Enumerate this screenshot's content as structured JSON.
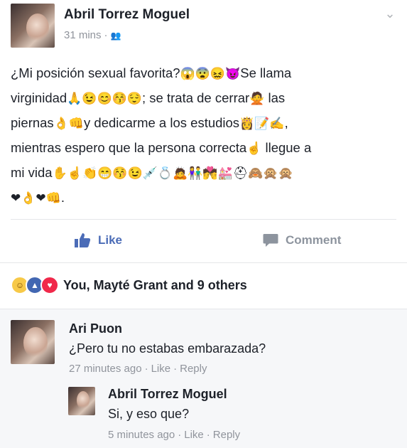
{
  "post": {
    "author": "Abril Torrez Moguel",
    "time": "31 mins",
    "meta_separator": "·",
    "audience_icon": "friends-icon",
    "text_lines": [
      [
        "¿Mi posición sexual favorita?",
        "😱😨😖😈",
        "Se llama"
      ],
      [
        "virginidad",
        "🙏😉😊😚😌",
        "; se trata de cerrar",
        "🙅",
        " las"
      ],
      [
        "piernas",
        "👌👊",
        "y dedicarme a los estudios",
        "👸📝✍",
        ","
      ],
      [
        "mientras espero que la persona correcta",
        "☝",
        " llegue a"
      ],
      [
        "mi vida",
        "✋☝👏😁😚😉💉💍🙇👫💏💒⛑🙈🙊🙊"
      ],
      [
        "",
        "❤👌❤👊",
        "."
      ]
    ]
  },
  "actions": {
    "like_label": "Like",
    "comment_label": "Comment"
  },
  "reactions": {
    "icons": [
      "haha-icon",
      "like-icon",
      "love-icon"
    ],
    "summary": "You, Mayté Grant and 9 others"
  },
  "comments": [
    {
      "author": "Ari Puon",
      "text": "¿Pero tu no estabas embarazada?",
      "time": "27 minutes ago",
      "like": "Like",
      "reply": "Reply",
      "sep": "·"
    },
    {
      "author": "Abril Torrez Moguel",
      "text": "Si, y eso que?",
      "time": "5 minutes ago",
      "like": "Like",
      "reply": "Reply",
      "sep": "·"
    }
  ],
  "colors": {
    "link_blue": "#4b6cb7",
    "muted": "#90949c",
    "love_red": "#f0284a"
  }
}
